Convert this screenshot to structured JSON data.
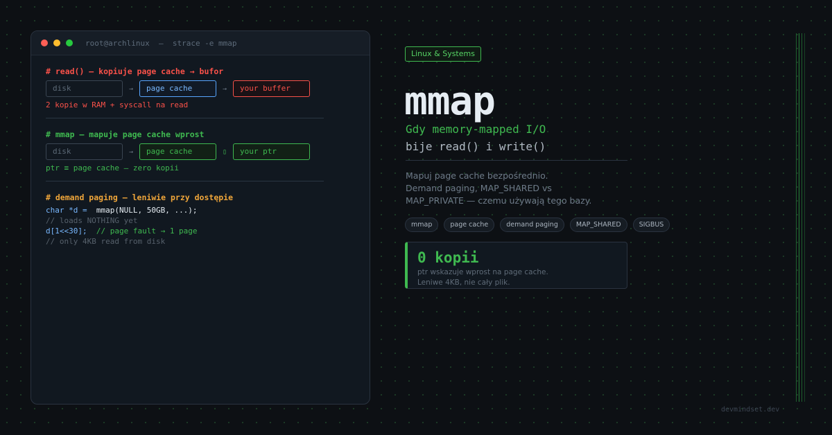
{
  "terminal": {
    "title": "root@archlinux  —  strace -e mmap",
    "section1": {
      "heading": "# read() — kopiuje page cache → bufor",
      "boxes": [
        "disk",
        "page cache",
        "your buffer"
      ],
      "arrows": [
        "→",
        "→"
      ],
      "note": "2 kopie w RAM + syscall na read"
    },
    "section2": {
      "heading": "# mmap — mapuje page cache wprost",
      "boxes": [
        "disk",
        "page cache",
        "your ptr"
      ],
      "arrows": [
        "→",
        "▯"
      ],
      "note": "ptr ≡ page cache — zero kopii"
    },
    "section3": {
      "heading": "# demand paging — leniwie przy dostępie",
      "code_line1_type": "char *d = ",
      "code_line1_call": " mmap(NULL, 50GB, ...);",
      "code_line2": "// loads NOTHING yet",
      "code_line3_expr": "d[1<<30];",
      "code_line3_comment": "  // page fault → 1 page",
      "code_line4": "// only 4KB read from disk"
    }
  },
  "hero": {
    "badge": "Linux & Systems",
    "title": "mmap",
    "subtitle_line1": "Gdy memory-mapped I/O",
    "subtitle_line2": "bije read() i write()",
    "description": [
      "Mapuj page cache bezpośrednio.",
      "Demand paging, MAP_SHARED vs",
      "MAP_PRIVATE — czemu używają tego bazy."
    ],
    "tags": [
      "mmap",
      "page cache",
      "demand paging",
      "MAP_SHARED",
      "SIGBUS"
    ],
    "stat": {
      "value": "0 kopii",
      "line1": "ptr wskazuje wprost na page cache.",
      "line2": "Leniwe 4KB, nie cały plik."
    }
  },
  "footer": {
    "site": "devmindset.dev"
  },
  "colors": {
    "accent_green": "#3fb950",
    "read_red": "#f85149",
    "demand_orange": "#f0a63a",
    "background": "#0d1014"
  }
}
